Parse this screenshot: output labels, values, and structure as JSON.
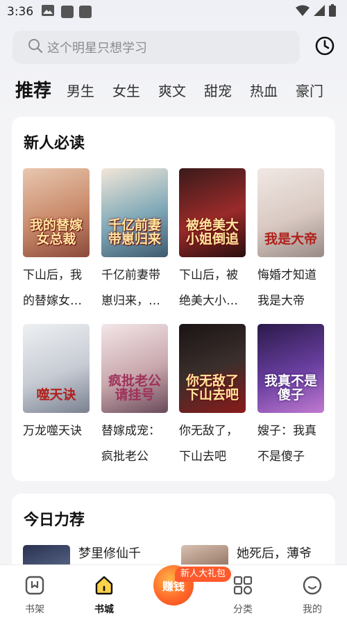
{
  "status_bar": {
    "time": "3:36"
  },
  "search": {
    "placeholder": "这个明星只想学习"
  },
  "tabs": [
    "推荐",
    "男生",
    "女生",
    "爽文",
    "甜宠",
    "热血",
    "豪门"
  ],
  "section_new": {
    "title": "新人必读",
    "books": [
      {
        "title": "下山后，我的替嫁女总裁",
        "cover_text": "我的替嫁女总裁",
        "color": "#c98a6a"
      },
      {
        "title": "千亿前妻带崽归来，渣男",
        "cover_text": "千亿前妻带崽归来",
        "color": "#7fa9b8"
      },
      {
        "title": "下山后，被绝美大小姐倒追",
        "cover_text": "被绝美大小姐倒追",
        "color": "#9a2a2a"
      },
      {
        "title": "悔婚才知道我是大帝",
        "cover_text": "我是大帝",
        "color": "#d9c9c2"
      },
      {
        "title": "万龙噬天诀",
        "cover_text": "噬天诀",
        "color": "#c7ccd4"
      },
      {
        "title": "替嫁成宠：疯批老公",
        "cover_text": "疯批老公请挂号",
        "color": "#c9a8ad"
      },
      {
        "title": "你无敌了，下山去吧",
        "cover_text": "你无敌了下山去吧",
        "color": "#3a2f2c"
      },
      {
        "title": "嫂子：我真不是傻子",
        "cover_text": "我真不是傻子",
        "color": "#6a3fa0"
      }
    ]
  },
  "section_today": {
    "title": "今日力荐",
    "items": [
      {
        "title": "梦里修仙千",
        "color": "#5a6a8a"
      },
      {
        "title": "她死后，薄爷",
        "color": "#8a6a5a"
      }
    ]
  },
  "earn_badge": "新人大礼包",
  "nav": {
    "bookshelf": "书架",
    "store": "书城",
    "earn": "赚钱",
    "category": "分类",
    "mine": "我的"
  }
}
